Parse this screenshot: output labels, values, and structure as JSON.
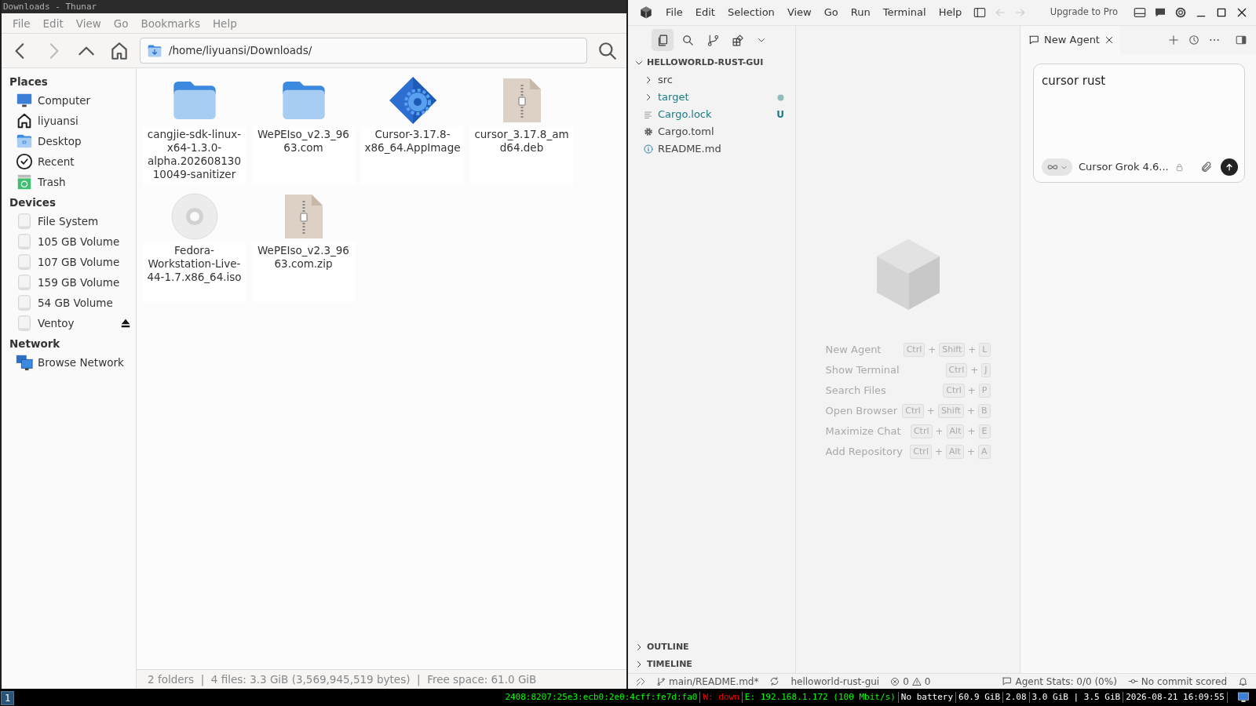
{
  "thunar": {
    "window": {
      "title": "Downloads - Thunar"
    },
    "menu": [
      "File",
      "Edit",
      "View",
      "Go",
      "Bookmarks",
      "Help"
    ],
    "nav": [
      {
        "kind": "back",
        "disabled": false
      },
      {
        "kind": "forward",
        "disabled": true
      },
      {
        "kind": "up",
        "disabled": false
      },
      {
        "kind": "home",
        "disabled": false
      }
    ],
    "location": {
      "path": "/home/liyuansi/Downloads/"
    },
    "sidebar": [
      {
        "heading": "Places",
        "items": [
          {
            "label": "Computer",
            "kind": "computer"
          },
          {
            "label": "liyuansi",
            "kind": "home"
          },
          {
            "label": "Desktop",
            "kind": "desktop"
          },
          {
            "label": "Recent",
            "kind": "recent"
          },
          {
            "label": "Trash",
            "kind": "trash"
          }
        ]
      },
      {
        "heading": "Devices",
        "items": [
          {
            "label": "File System",
            "kind": "drive"
          },
          {
            "label": "105 GB Volume",
            "kind": "drive"
          },
          {
            "label": "107 GB Volume",
            "kind": "drive"
          },
          {
            "label": "159 GB Volume",
            "kind": "drive"
          },
          {
            "label": "54 GB Volume",
            "kind": "drive"
          },
          {
            "label": "Ventoy",
            "kind": "removable"
          }
        ]
      },
      {
        "heading": "Network",
        "items": [
          {
            "label": "Browse Network",
            "kind": "network"
          }
        ]
      }
    ],
    "files": [
      {
        "name": "cangjie-sdk-linux-x64-1.3.0-alpha.20260813010049-sanitizer",
        "kind": "folder"
      },
      {
        "name": "WePEIso_v2.3_9663.com",
        "kind": "folder"
      },
      {
        "name": "Cursor-3.17.8-x86_64.AppImage",
        "kind": "appimage"
      },
      {
        "name": "cursor_3.17.8_amd64.deb",
        "kind": "archive"
      },
      {
        "name": "Fedora-Workstation-Live-44-1.7.x86_64.iso",
        "kind": "disc"
      },
      {
        "name": "WePEIso_v2.3_9663.com.zip",
        "kind": "archive"
      }
    ],
    "status_bar": "2 folders  |  4 files: 3.3 GiB (3,569,945,519 bytes)  |  Free space: 61.0 GiB"
  },
  "cursor": {
    "menu": [
      "File",
      "Edit",
      "Selection",
      "View",
      "Go",
      "Run",
      "Terminal",
      "Help"
    ],
    "nav": [
      {
        "kind": "back",
        "disabled": true
      },
      {
        "kind": "forward",
        "disabled": true
      }
    ],
    "upgrade": "Upgrade to Pro",
    "views": [
      {
        "kind": "files",
        "selected": true
      },
      {
        "kind": "search",
        "selected": false
      },
      {
        "kind": "source-control",
        "selected": false
      },
      {
        "kind": "extensions",
        "selected": false
      }
    ],
    "explorer": {
      "root": "HELLOWORLD-RUST-GUI",
      "expanded": true,
      "items": [
        {
          "label": "src",
          "kind": "folder",
          "expanded": false,
          "color": "#444444",
          "dot": false
        },
        {
          "label": "target",
          "kind": "folder",
          "expanded": false,
          "color": "#1d7a82",
          "dot": true
        },
        {
          "label": "Cargo.lock",
          "kind": "lines",
          "color": "#1d7a82",
          "dot": false,
          "badge": "U"
        },
        {
          "label": "Cargo.toml",
          "kind": "gear",
          "color": "#444444",
          "dot": false
        },
        {
          "label": "README.md",
          "kind": "info",
          "color": "#444444",
          "dot": false
        }
      ],
      "sections": [
        {
          "label": "OUTLINE",
          "expanded": false
        },
        {
          "label": "TIMELINE",
          "expanded": false
        }
      ]
    },
    "shortcuts": [
      {
        "label": "New Agent",
        "parts": [
          "Ctrl",
          "+",
          "Shift",
          "+",
          "L"
        ]
      },
      {
        "label": "Show Terminal",
        "parts": [
          "Ctrl",
          "+",
          "J"
        ]
      },
      {
        "label": "Search Files",
        "parts": [
          "Ctrl",
          "+",
          "P"
        ]
      },
      {
        "label": "Open Browser",
        "parts": [
          "Ctrl",
          "+",
          "Shift",
          "+",
          "B"
        ]
      },
      {
        "label": "Maximize Chat",
        "parts": [
          "Ctrl",
          "+",
          "Alt",
          "+",
          "E"
        ]
      },
      {
        "label": "Add Repository",
        "parts": [
          "Ctrl",
          "+",
          "Alt",
          "+",
          "A"
        ]
      }
    ],
    "agent": {
      "tab": "New Agent",
      "input": "cursor rust",
      "model": "Cursor Grok 4.6..."
    },
    "status_left": [
      {
        "kind": "remote"
      },
      {
        "kind": "branch",
        "text": "main/README.md*"
      },
      {
        "kind": "sync"
      },
      {
        "kind": "text",
        "text": "helloworld-rust-gui"
      },
      {
        "kind": "problems",
        "errors": "0",
        "warnings": "0"
      }
    ],
    "status_right": [
      {
        "kind": "agent",
        "text": "Agent Stats: 0/0 (0%)"
      },
      {
        "kind": "commit",
        "text": "No commit scored"
      },
      {
        "kind": "bell"
      }
    ]
  },
  "taskbar": {
    "workspace": "1",
    "segments": [
      {
        "text": "2408:8207:25e3:ecb0:2e0:4cff:fe7d:fa0",
        "color": "#00ff00"
      },
      {
        "text": "W: down",
        "color": "#ff0000"
      },
      {
        "text": "E: 192.168.1.172 (100 Mbit/s)",
        "color": "#00ff00"
      },
      {
        "text": "No battery",
        "color": "#ffffff"
      },
      {
        "text": "60.9 GiB",
        "color": "#ffffff"
      },
      {
        "text": "2.08",
        "color": "#ffffff"
      },
      {
        "text": "3.0 GiB | 3.5 GiB",
        "color": "#ffffff"
      },
      {
        "text": "2026-08-21 16:09:55",
        "color": "#ffffff"
      }
    ]
  }
}
